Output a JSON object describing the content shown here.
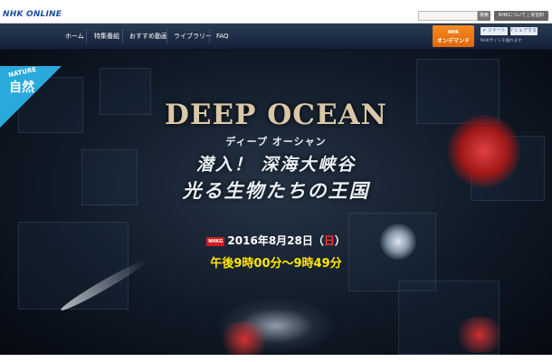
{
  "header": {
    "logo": "NHK ONLINE",
    "search_placeholder": "",
    "search_button": "検索",
    "about_link": "NHKについて | 受信料"
  },
  "nav": {
    "items": [
      "ホーム",
      "特集番組",
      "おすすめ動画",
      "ライブラリー",
      "FAQ"
    ],
    "ondemand": {
      "line1": "NHK",
      "line2": "オンデマンド"
    },
    "tweet": "ツイート",
    "share": "シェアする",
    "site_note": "NHKサイトを離れます"
  },
  "badge": {
    "nature": "NATURE",
    "shizen": "自然",
    "color": "#2aa9dc"
  },
  "hero": {
    "title_en": "DEEP OCEAN",
    "title_ja": "ディープ オーシャン",
    "subtitle_1": "潜入！ 深海大峡谷",
    "subtitle_2": "光る生物たちの王国",
    "channel": "NHKG",
    "date": "2016年8月28日",
    "open_paren": "（",
    "weekday": "日",
    "close_paren": "）",
    "time": "午後9時00分～9時49分"
  },
  "colors": {
    "nav_bg": "#1b2b44",
    "ondemand": "#f07a12",
    "time": "#ffe600",
    "weekday": "#ff2f2f"
  }
}
